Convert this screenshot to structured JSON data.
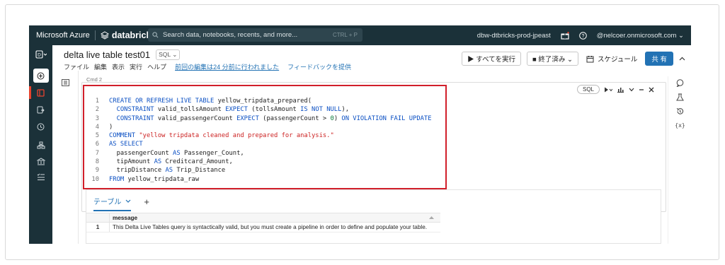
{
  "topbar": {
    "azure_label": "Microsoft Azure",
    "brand": "databricks",
    "search_placeholder": "Search data, notebooks, recents, and more...",
    "search_shortcut": "CTRL + P",
    "workspace": "dbw-dtbricks-prod-jpeast",
    "account": "@nelcoer.onmicrosoft.com ⌄"
  },
  "notebook": {
    "title": "delta live table test01",
    "language": "SQL ⌄",
    "menus": [
      "ファイル",
      "編集",
      "表示",
      "実行",
      "ヘルプ"
    ],
    "last_edit": "前回の編集は24 分前に行われました",
    "feedback": "フィードバックを提供",
    "run_all": "▶ すべてを実行",
    "cluster": "■ 終了済み ⌄",
    "schedule": "スケジュール",
    "share": "共 有"
  },
  "cell": {
    "cmd_label": "Cmd 2",
    "lang_pill": "SQL",
    "code_lines": [
      {
        "n": "1",
        "parts": [
          [
            "kw",
            "CREATE OR REFRESH LIVE TABLE "
          ],
          [
            "txt",
            "yellow_tripdata_prepared("
          ]
        ]
      },
      {
        "n": "2",
        "parts": [
          [
            "txt",
            "  "
          ],
          [
            "kw",
            "CONSTRAINT "
          ],
          [
            "txt",
            "valid_tollsAmount "
          ],
          [
            "kw",
            "EXPECT "
          ],
          [
            "txt",
            "(tollsAmount "
          ],
          [
            "kw",
            "IS NOT NULL"
          ],
          [
            "txt",
            "),"
          ]
        ]
      },
      {
        "n": "3",
        "parts": [
          [
            "txt",
            "  "
          ],
          [
            "kw",
            "CONSTRAINT "
          ],
          [
            "txt",
            "valid_passengerCount "
          ],
          [
            "kw",
            "EXPECT "
          ],
          [
            "txt",
            "(passengerCount > "
          ],
          [
            "num",
            "0"
          ],
          [
            "txt",
            ") "
          ],
          [
            "kw",
            "ON VIOLATION FAIL UPDATE"
          ]
        ]
      },
      {
        "n": "4",
        "parts": [
          [
            "txt",
            ")"
          ]
        ]
      },
      {
        "n": "5",
        "parts": [
          [
            "kw",
            "COMMENT "
          ],
          [
            "str",
            "\"yellow tripdata cleaned and prepared for analysis.\""
          ]
        ]
      },
      {
        "n": "6",
        "parts": [
          [
            "kw",
            "AS SELECT"
          ]
        ]
      },
      {
        "n": "7",
        "parts": [
          [
            "txt",
            "  passengerCount "
          ],
          [
            "kw",
            "AS "
          ],
          [
            "txt",
            "Passenger_Count,"
          ]
        ]
      },
      {
        "n": "8",
        "parts": [
          [
            "txt",
            "  tipAmount "
          ],
          [
            "kw",
            "AS "
          ],
          [
            "txt",
            "Creditcard_Amount,"
          ]
        ]
      },
      {
        "n": "9",
        "parts": [
          [
            "txt",
            "  tripDistance "
          ],
          [
            "kw",
            "AS "
          ],
          [
            "txt",
            "Trip_Distance"
          ]
        ]
      },
      {
        "n": "10",
        "parts": [
          [
            "kw",
            "FROM "
          ],
          [
            "txt",
            "yellow_tripdata_raw"
          ]
        ]
      }
    ]
  },
  "results": {
    "tab_label": "テーブル",
    "column": "message",
    "rows": [
      {
        "idx": "1",
        "message": "This Delta Live Tables query is syntactically valid, but you must create a pipeline in order to define and populate your table."
      }
    ]
  }
}
